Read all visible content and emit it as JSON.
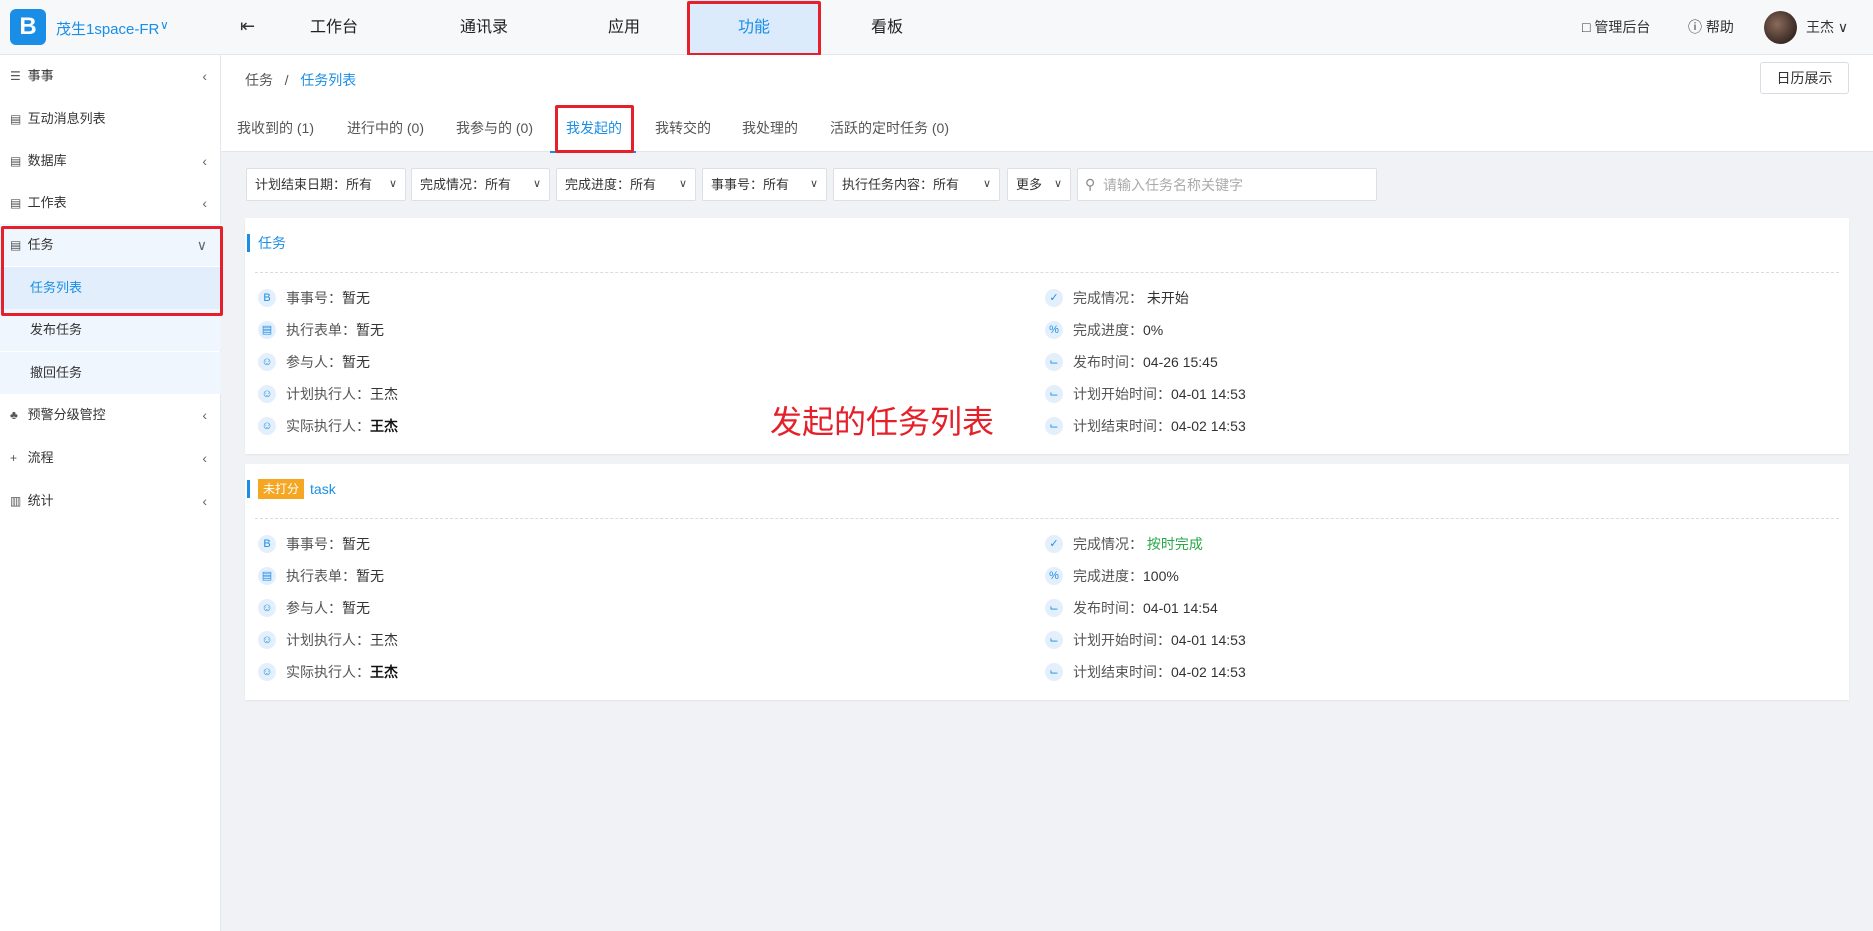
{
  "topbar": {
    "logo_text": "B",
    "brand": "茂生1space-FR",
    "nav": [
      "工作台",
      "通讯录",
      "应用",
      "功能",
      "看板"
    ],
    "active_nav": "功能",
    "admin": "管理后台",
    "help": "帮助",
    "user": "王杰"
  },
  "sidebar": {
    "items": {
      "shishi": "事事",
      "interaction": "互动消息列表",
      "database": "数据库",
      "worksheet": "工作表",
      "task": "任务",
      "task_list": "任务列表",
      "publish_task": "发布任务",
      "revoke_task": "撤回任务",
      "alert": "预警分级管控",
      "flow": "流程",
      "stats": "统计"
    }
  },
  "breadcrumb": {
    "root": "任务",
    "sep": "/",
    "current": "任务列表"
  },
  "calendar_button": "日历展示",
  "tabs": [
    "我收到的 (1)",
    "进行中的 (0)",
    "我参与的 (0)",
    "我发起的",
    "我转交的",
    "我处理的",
    "活跃的定时任务 (0)"
  ],
  "active_tab": "我发起的",
  "filters": [
    {
      "label": "计划结束日期：",
      "value": "所有"
    },
    {
      "label": "完成情况：",
      "value": "所有"
    },
    {
      "label": "完成进度：",
      "value": "所有"
    },
    {
      "label": "事事号：",
      "value": "所有"
    },
    {
      "label": "执行任务内容：",
      "value": "所有"
    },
    {
      "label": "更多",
      "value": ""
    }
  ],
  "search": {
    "placeholder": "请输入任务名称关键字"
  },
  "cards": [
    {
      "badge": "",
      "title": "任务",
      "left": [
        {
          "label": "事事号：",
          "value": "暂无"
        },
        {
          "label": "执行表单：",
          "value": "暂无"
        },
        {
          "label": "参与人：",
          "value": "暂无"
        },
        {
          "label": "计划执行人：",
          "value": "王杰"
        },
        {
          "label": "实际执行人：",
          "value": "王杰"
        }
      ],
      "right": [
        {
          "label": "完成情况：",
          "value": "未开始"
        },
        {
          "label": "完成进度：",
          "value": "0%"
        },
        {
          "label": "发布时间：",
          "value": "04-26 15:45"
        },
        {
          "label": "计划开始时间：",
          "value": "04-01 14:53"
        },
        {
          "label": "计划结束时间：",
          "value": "04-02 14:53"
        }
      ]
    },
    {
      "badge": "未打分",
      "title": "task",
      "left": [
        {
          "label": "事事号：",
          "value": "暂无"
        },
        {
          "label": "执行表单：",
          "value": "暂无"
        },
        {
          "label": "参与人：",
          "value": "暂无"
        },
        {
          "label": "计划执行人：",
          "value": "王杰"
        },
        {
          "label": "实际执行人：",
          "value": "王杰"
        }
      ],
      "right": [
        {
          "label": "完成情况：",
          "value": "按时完成"
        },
        {
          "label": "完成进度：",
          "value": "100%"
        },
        {
          "label": "发布时间：",
          "value": "04-01 14:54"
        },
        {
          "label": "计划开始时间：",
          "value": "04-01 14:53"
        },
        {
          "label": "计划结束时间：",
          "value": "04-02 14:53"
        }
      ]
    }
  ],
  "annotation": "发起的任务列表",
  "colors": {
    "accent": "#1a8ee6",
    "highlight": "#e5202a",
    "badge": "#f5a623",
    "success": "#2aa84a"
  }
}
